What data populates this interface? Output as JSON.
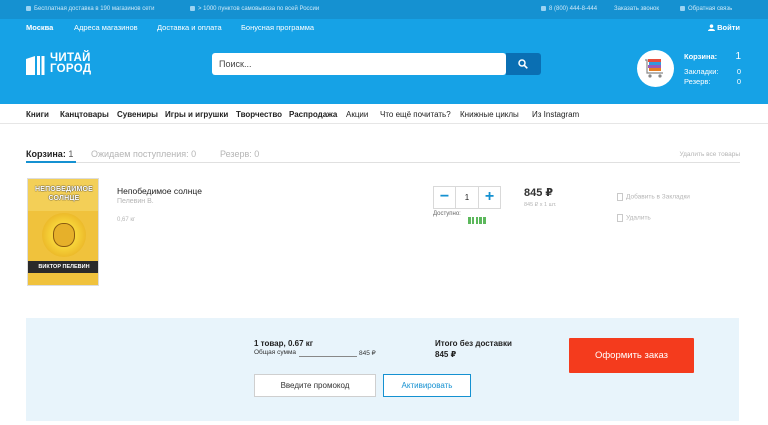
{
  "topbar": {
    "delivery": "Бесплатная доставка в 190 магазинов сети",
    "pickup": "> 1000 пунктов самовывоза по всей России",
    "phone": "8 (800) 444-8-444",
    "callback": "Заказать звонок",
    "feedback": "Обратная связь"
  },
  "navbar": {
    "city": "Москва",
    "links": [
      "Адреса магазинов",
      "Доставка и оплата",
      "Бонусная программа"
    ],
    "login": "Войти"
  },
  "logo": {
    "line1": "ЧИТАЙ",
    "line2": "ГОРОД"
  },
  "search": {
    "placeholder": "Поиск..."
  },
  "cart": {
    "title": "Корзина:",
    "count": "1",
    "bookmarks_label": "Закладки:",
    "bookmarks": "0",
    "reserve_label": "Резерв:",
    "reserve": "0"
  },
  "categories": [
    {
      "label": "Книги",
      "bold": true
    },
    {
      "label": "Канцтовары",
      "bold": true
    },
    {
      "label": "Сувениры",
      "bold": true
    },
    {
      "label": "Игры и игрушки",
      "bold": true
    },
    {
      "label": "Творчество",
      "bold": true
    },
    {
      "label": "Распродажа",
      "bold": true
    },
    {
      "label": "Акции",
      "bold": false
    },
    {
      "label": "Что ещё почитать?",
      "bold": false
    },
    {
      "label": "Книжные циклы",
      "bold": false
    },
    {
      "label": "Из Instagram",
      "bold": false
    }
  ],
  "tabs": {
    "cart": "Корзина:",
    "cart_count": "1",
    "waiting": "Ожидаем поступления:",
    "waiting_count": "0",
    "reserve": "Резерв:",
    "reserve_count": "0",
    "remove_all": "Удалить все товары"
  },
  "item": {
    "cover_title": "НЕПОБЕДИМОЕ СОЛНЦЕ",
    "cover_author": "ВИКТОР ПЕЛЕВИН",
    "title": "Непобедимое солнце",
    "author": "Пелевин В.",
    "weight": "0,67 кг",
    "quantity": "1",
    "available_label": "Доступно:",
    "availability_level": 5,
    "price": "845 ₽",
    "price_each": "845 ₽ x 1 шт.",
    "bookmark_action": "Добавить в Закладки",
    "delete_action": "Удалить"
  },
  "summary": {
    "count": "1 товар, 0.67 кг",
    "total_label": "Общая сумма",
    "total_value": "845 ₽",
    "grand_label": "Итого без доставки",
    "grand_value": "845 ₽",
    "order_button": "Оформить заказ",
    "promo_placeholder": "Введите промокод",
    "activate_button": "Активировать"
  },
  "colors": {
    "brand_blue": "#16a2e6",
    "dark_blue": "#0a6fb3",
    "order_red": "#f43b1d",
    "summary_bg": "#e8f4fb"
  }
}
